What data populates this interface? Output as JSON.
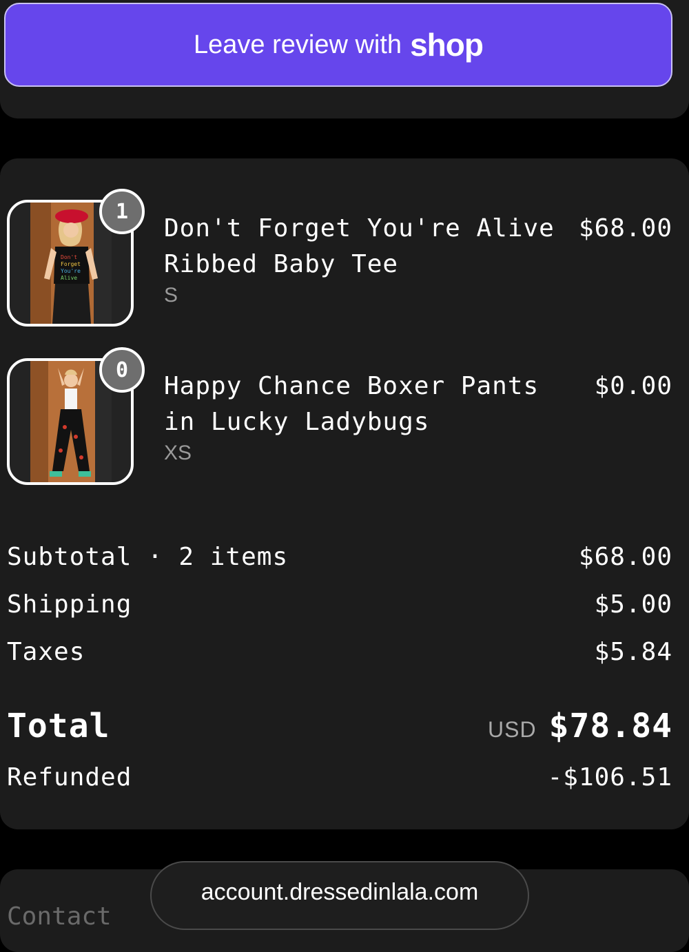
{
  "review": {
    "label": "Leave review with",
    "brand": "shop",
    "color": "#6646ec"
  },
  "items": [
    {
      "name": "Don't Forget You're Alive Ribbed Baby Tee",
      "variant": "S",
      "price": "$68.00",
      "quantity": "1"
    },
    {
      "name": "Happy Chance Boxer Pants in Lucky Ladybugs",
      "variant": "XS",
      "price": "$0.00",
      "quantity": "0"
    }
  ],
  "summary": {
    "subtotal_label": "Subtotal · 2 items",
    "subtotal_value": "$68.00",
    "shipping_label": "Shipping",
    "shipping_value": "$5.00",
    "taxes_label": "Taxes",
    "taxes_value": "$5.84",
    "total_label": "Total",
    "total_currency": "USD",
    "total_value": "$78.84",
    "refunded_label": "Refunded",
    "refunded_value": "-$106.51"
  },
  "contact": {
    "label": "Contact"
  },
  "browser": {
    "url": "account.dressedinlala.com"
  }
}
